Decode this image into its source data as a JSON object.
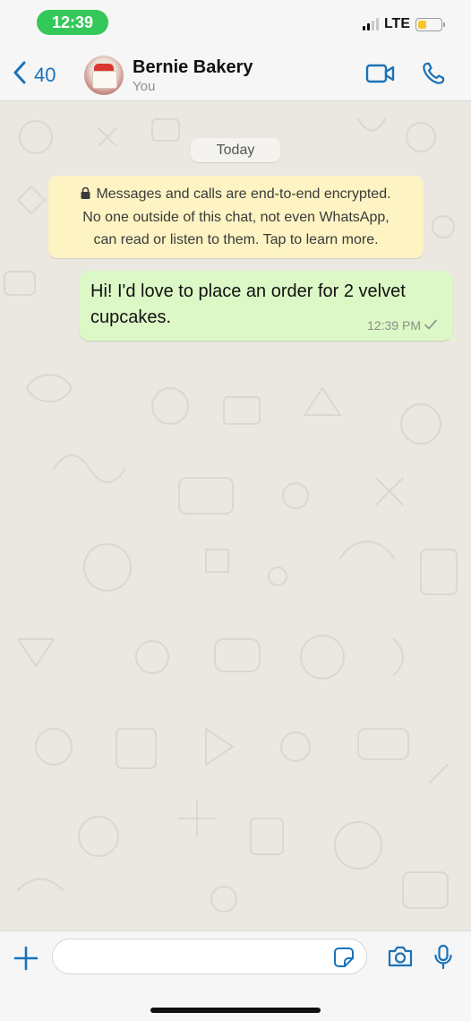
{
  "status_bar": {
    "time": "12:39",
    "network": "LTE",
    "battery_level": 0.4,
    "signal_bars_active": 2,
    "time_pill_color": "#34c759",
    "battery_color": "#f7c62f"
  },
  "header": {
    "back_count": "40",
    "contact_name": "Bernie Bakery",
    "contact_subtitle": "You",
    "accent_color": "#1a72b9",
    "icons": [
      "chevron-left-icon",
      "video-call-icon",
      "phone-icon"
    ]
  },
  "chat": {
    "date_chip": "Today",
    "encryption_notice": {
      "line1": "Messages and calls are end-to-end encrypted.",
      "line2": "No one outside of this chat, not even WhatsApp,",
      "line3": "can read or listen to them. Tap to learn more."
    },
    "messages": [
      {
        "direction": "outgoing",
        "line1": "Hi! I'd love to place an order for 2 velvet",
        "line2": "cupcakes.",
        "time": "12:39 PM",
        "status": "sent"
      }
    ],
    "background_color": "#ebe7e1",
    "outgoing_bubble_color": "#dcf8c6",
    "notice_color": "#fdf3c3"
  },
  "composer": {
    "input_value": "",
    "placeholder": "",
    "icons": [
      "plus-icon",
      "sticker-icon",
      "camera-icon",
      "microphone-icon"
    ]
  }
}
